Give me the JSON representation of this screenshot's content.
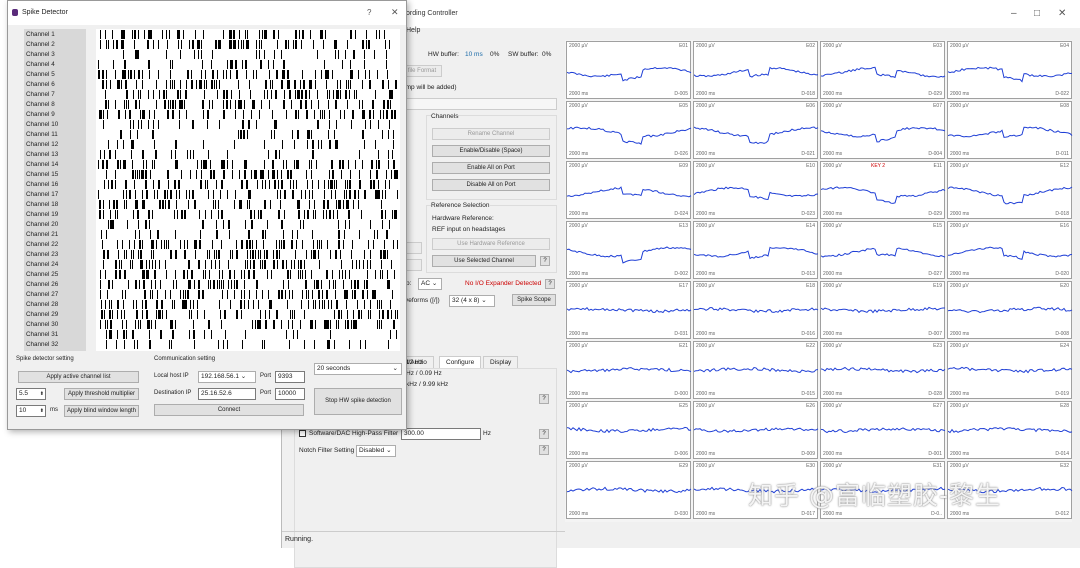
{
  "controller": {
    "title": "ording Controller",
    "menu": "Help",
    "hw_buffer_label": "HW buffer:",
    "hw_buffer_value": "10 ms",
    "hw_pct": "0%",
    "sw_buffer_label": "SW buffer:",
    "sw_pct": "0%",
    "file_format_btn": "file Format",
    "amp_note": "amp will be added)",
    "channels_group": "Channels",
    "rename_btn": "Rename Channel",
    "enable_disable_btn": "Enable/Disable (Space)",
    "enable_all_btn": "Enable All on Port",
    "disable_all_btn": "Disable All on Port",
    "ref_group": "Reference Selection",
    "hw_ref_label": "Hardware Reference:",
    "ref_input_label": "REF input on headstages",
    "use_hw_ref_btn": "Use Hardware Reference",
    "use_sel_ch_btn": "Use Selected Channel",
    "coupling_prefix": "p:",
    "coupling_value": "AC",
    "no_io_label": "No I/O Expander Detected",
    "waveforms_prefix": "veforms ([/])",
    "waveforms_value": "32 (4 x 8)",
    "spike_scope_btn": "Spike Scope",
    "tabs": [
      "ut/Audio",
      "Configure",
      "Display"
    ],
    "freq1": "12 Hz",
    "freq2": "Hz / 0.09 Hz",
    "freq3": "kHz / 9.99 kHz",
    "sw_hp_filter_label": "Software/DAC High-Pass Filter",
    "sw_hp_value": "300.00",
    "hz": "Hz",
    "notch_label": "Notch Filter Setting",
    "notch_value": "Disabled",
    "qm": "?",
    "status": "Running."
  },
  "scope": {
    "scale": "2000 µV",
    "time": "2000 ms",
    "key_label": "KEY 2",
    "channels": [
      {
        "name": "E01",
        "id": "D-005"
      },
      {
        "name": "E02",
        "id": "D-018"
      },
      {
        "name": "E03",
        "id": "D-029"
      },
      {
        "name": "E04",
        "id": "D-022"
      },
      {
        "name": "E05",
        "id": "D-026"
      },
      {
        "name": "E06",
        "id": "D-021"
      },
      {
        "name": "E07",
        "id": "D-004"
      },
      {
        "name": "E08",
        "id": "D-011"
      },
      {
        "name": "E09",
        "id": "D-024"
      },
      {
        "name": "E10",
        "id": "D-023"
      },
      {
        "name": "E11",
        "id": "D-029"
      },
      {
        "name": "E12",
        "id": "D-018"
      },
      {
        "name": "E13",
        "id": "D-002"
      },
      {
        "name": "E14",
        "id": "D-013"
      },
      {
        "name": "E15",
        "id": "D-027"
      },
      {
        "name": "E16",
        "id": "D-020"
      },
      {
        "name": "E17",
        "id": "D-031"
      },
      {
        "name": "E18",
        "id": "D-016"
      },
      {
        "name": "E19",
        "id": "D-007"
      },
      {
        "name": "E20",
        "id": "D-008"
      },
      {
        "name": "E21",
        "id": "D-000"
      },
      {
        "name": "E22",
        "id": "D-015"
      },
      {
        "name": "E23",
        "id": "D-028"
      },
      {
        "name": "E24",
        "id": "D-019"
      },
      {
        "name": "E25",
        "id": "D-006"
      },
      {
        "name": "E26",
        "id": "D-009"
      },
      {
        "name": "E27",
        "id": "D-001"
      },
      {
        "name": "E28",
        "id": "D-014"
      },
      {
        "name": "E29",
        "id": "D-030"
      },
      {
        "name": "E30",
        "id": "D-017"
      },
      {
        "name": "E31",
        "id": "D-0.."
      },
      {
        "name": "E32",
        "id": "D-012"
      }
    ]
  },
  "watermark": "知乎 @富临塑胶-黎生",
  "spike_detector": {
    "title": "Spike Detector",
    "help": "?",
    "close": "✕",
    "channels": [
      "Channel 1",
      "Channel 2",
      "Channel 3",
      "Channel 4",
      "Channel 5",
      "Channel 6",
      "Channel 7",
      "Channel 8",
      "Channel 9",
      "Channel 10",
      "Channel 11",
      "Channel 12",
      "Channel 13",
      "Channel 14",
      "Channel 15",
      "Channel 16",
      "Channel 17",
      "Channel 18",
      "Channel 19",
      "Channel 20",
      "Channel 21",
      "Channel 22",
      "Channel 23",
      "Channel 24",
      "Channel 25",
      "Channel 26",
      "Channel 27",
      "Channel 28",
      "Channel 29",
      "Channel 30",
      "Channel 31",
      "Channel 32"
    ],
    "detector_setting": "Spike detector setting",
    "apply_active_btn": "Apply active channel list",
    "threshold_value": "5.5",
    "apply_threshold_btn": "Apply threshold multiplier",
    "blind_value": "10",
    "ms": "ms",
    "apply_blind_btn": "Apply blind window length",
    "comm_setting": "Communication setting",
    "local_ip_label": "Local host IP",
    "local_ip": "192.168.56.1",
    "port_label": "Port",
    "local_port": "9393",
    "dest_ip_label": "Destination IP",
    "dest_ip": "25.16.52.6",
    "dest_port": "10000",
    "connect_btn": "Connect",
    "duration": "20 seconds",
    "stop_btn": "Stop HW spike detection"
  }
}
